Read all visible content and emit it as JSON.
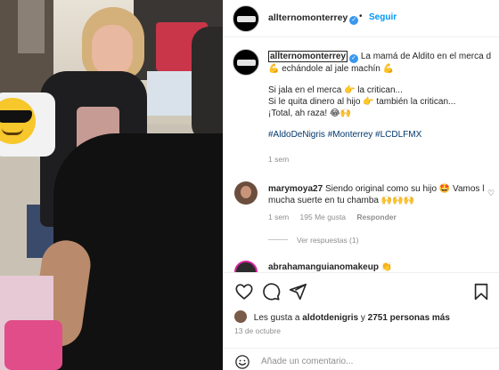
{
  "post": {
    "username": "allternomonterrey",
    "follow_label": "Seguir",
    "header_separator": "•",
    "verified_glyph": "✓"
  },
  "caption": {
    "username": "allternomonterrey",
    "line1": "La mamá de Aldito en el merca d",
    "line2": "echándole al jale machín",
    "line3": "Si jala en el merca",
    "line3_end": "la critican...",
    "line4": "Si le quita dinero al hijo",
    "line4_end": "también la critican...",
    "line5": "¡Total, ah raza!",
    "emoji_bicep": "💪",
    "emoji_point": "👉",
    "emoji_laugh": "😂🙌",
    "emoji_lead": "💪",
    "hashtags": "#AldoDeNigris #Monterrey #LCDLFMX",
    "time": "1 sem"
  },
  "comments": [
    {
      "username": "marymoya27",
      "text": "Siendo original como su hijo",
      "emoji": "🤩",
      "text_tail": "Vamos l",
      "line2": "mucha suerte en tu chamba",
      "line2_emoji": "🙌🙌🙌",
      "time": "1 sem",
      "likes": "195 Me gusta",
      "reply_label": "Responder",
      "heart_glyph": "♡",
      "view_replies": "Ver respuestas (1)"
    },
    {
      "username": "abrahamanguianomakeup",
      "emoji": "👏"
    }
  ],
  "actions": {
    "likes_prefix": "Les gusta a",
    "likes_user": "aldotdenigris",
    "likes_mid": "y",
    "likes_count": "2751 personas más",
    "date": "13 de octubre",
    "comment_placeholder": "Añade un comentario..."
  },
  "photo": {
    "sticker_emoji": "😎"
  },
  "colors": {
    "link": "#0095f6",
    "hashtag": "#00376b",
    "muted": "#8e8e8e",
    "verified": "#3897f0"
  },
  "icons": [
    "heart-icon",
    "comment-icon",
    "share-icon",
    "bookmark-icon",
    "smiley-icon",
    "verified-icon"
  ]
}
